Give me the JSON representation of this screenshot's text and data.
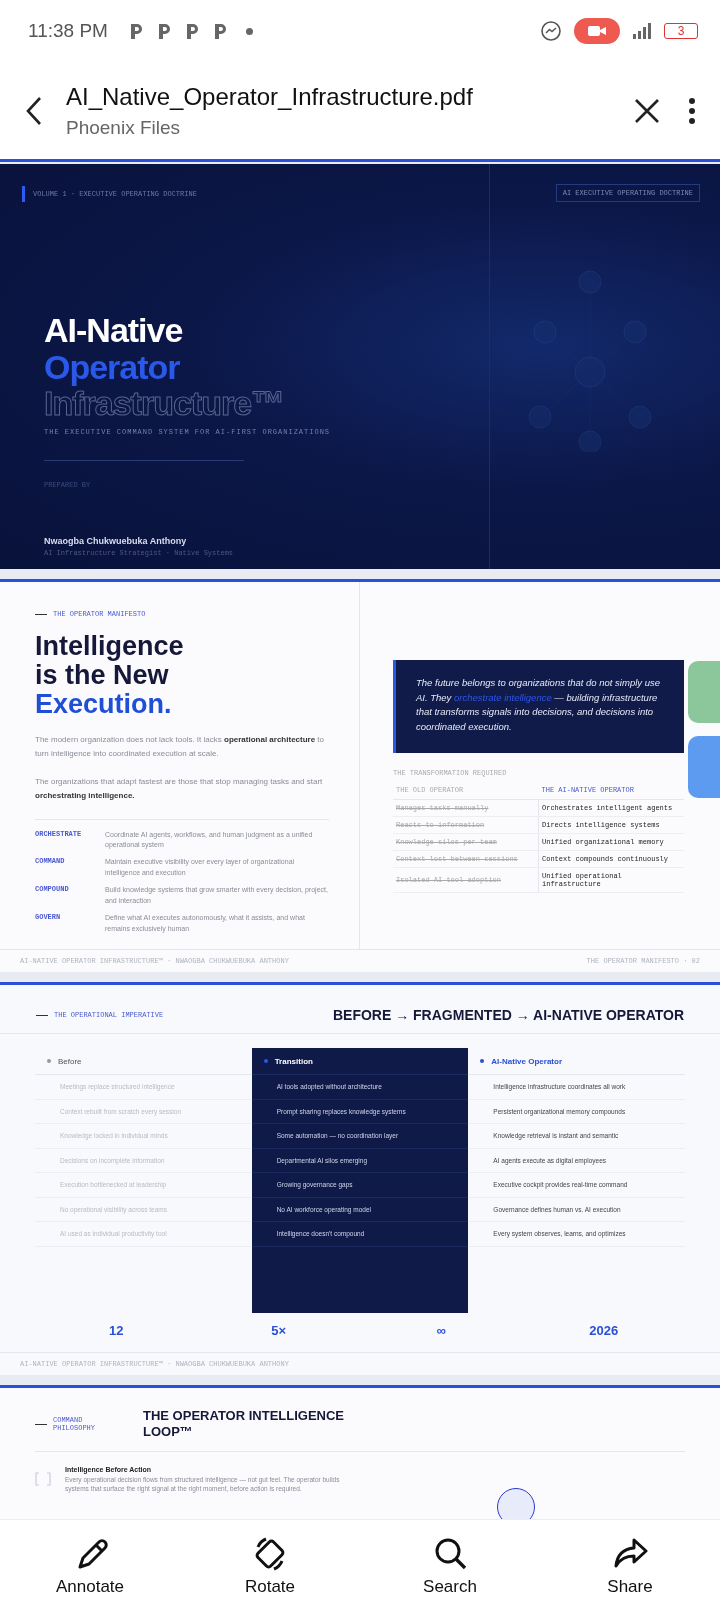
{
  "status_bar": {
    "time": "11:38 PM",
    "battery": "3"
  },
  "app_bar": {
    "title": "AI_Native_Operator_Infrastructure.pdf",
    "subtitle": "Phoenix Files"
  },
  "cover": {
    "eyebrow": "VOLUME 1 · EXECUTIVE OPERATING DOCTRINE",
    "badge": "AI EXECUTIVE OPERATING DOCTRINE",
    "title": [
      {
        "text": "AI-Native",
        "kind": "solid"
      },
      {
        "text": "Operator",
        "kind": "accent"
      },
      {
        "text": "Infrastructure™",
        "kind": "outline"
      }
    ],
    "subtitle": "THE EXECUTIVE COMMAND SYSTEM FOR AI-FIRST ORGANIZATIONS",
    "prepared_label": "PREPARED BY",
    "author": "Nwaogba Chukwuebuka Anthony",
    "author_role": "AI Infrastructure Strategist · Native Systems"
  },
  "manifesto": {
    "eyebrow": "THE OPERATOR MANIFESTO",
    "heading": [
      {
        "text": "Intelligence",
        "kind": "solid"
      },
      {
        "text": "is the New",
        "kind": "solid"
      },
      {
        "text": "Execution.",
        "kind": "accent"
      }
    ],
    "paragraphs": [
      "The modern organization does not lack tools. It lacks **operational architecture** to turn intelligence into coordinated execution at scale.",
      "The organizations that adapt fastest are those that stop managing tasks and start **orchestrating intelligence.**"
    ],
    "principles": [
      {
        "key": "ORCHESTRATE",
        "text": "Coordinate AI agents, workflows, and human judgment as a unified operational system"
      },
      {
        "key": "COMMAND",
        "text": "Maintain executive visibility over every layer of organizational intelligence and execution"
      },
      {
        "key": "COMPOUND",
        "text": "Build knowledge systems that grow smarter with every decision, project, and interaction"
      },
      {
        "key": "GOVERN",
        "text": "Define what AI executes autonomously, what it assists, and what remains exclusively human"
      }
    ],
    "quote": {
      "before": "The future belongs to organizations that do not simply use AI. They ",
      "highlight": "orchestrate intelligence",
      "after": " — building infrastructure that transforms signals into decisions, and decisions into coordinated execution."
    },
    "table_title": "THE TRANSFORMATION REQUIRED",
    "columns": [
      "THE OLD OPERATOR",
      "THE AI-NATIVE OPERATOR"
    ],
    "rows": [
      [
        "Manages tasks manually",
        "Orchestrates intelligent agents"
      ],
      [
        "Reacts to information",
        "Directs intelligence systems"
      ],
      [
        "Knowledge silos per team",
        "Unified organizational memory"
      ],
      [
        "Context lost between sessions",
        "Context compounds continuously"
      ],
      [
        "Isolated AI tool adoption",
        "Unified operational infrastructure"
      ]
    ],
    "footer_left": "AI-NATIVE OPERATOR INFRASTRUCTURE™ · NWAOGBA CHUKWUEBUKA ANTHONY",
    "footer_right": "THE OPERATOR MANIFESTO · 02"
  },
  "imperative": {
    "eyebrow": "THE OPERATIONAL IMPERATIVE",
    "heading": "BEFORE → FRAGMENTED → AI-NATIVE OPERATOR",
    "columns": [
      {
        "title": "Before",
        "kind": "before",
        "items": [
          "Meetings replace structured intelligence",
          "Context rebuilt from scratch every session",
          "Knowledge locked in individual minds",
          "Decisions on incomplete information",
          "Execution bottlenecked at leadership",
          "No operational visibility across teams",
          "AI used as individual productivity tool"
        ]
      },
      {
        "title": "Transition",
        "kind": "transition",
        "items": [
          "AI tools adopted without architecture",
          "Prompt sharing replaces knowledge systems",
          "Some automation — no coordination layer",
          "Departmental AI silos emerging",
          "Growing governance gaps",
          "No AI workforce operating model",
          "Intelligence doesn't compound"
        ]
      },
      {
        "title": "AI-Native Operator",
        "kind": "native",
        "items": [
          "Intelligence infrastructure coordinates all work",
          "Persistent organizational memory compounds",
          "Knowledge retrieval is instant and semantic",
          "AI agents execute as digital employees",
          "Executive cockpit provides real-time command",
          "Governance defines human vs. AI execution",
          "Every system observes, learns, and optimizes"
        ]
      }
    ],
    "stats": [
      "12",
      "5×",
      "∞",
      "2026"
    ],
    "footer_left": "AI-NATIVE OPERATOR INFRASTRUCTURE™ · NWAOGBA CHUKWUEBUKA ANTHONY"
  },
  "loop": {
    "eyebrow": "COMMAND PHILOSOPHY",
    "heading": "THE OPERATOR INTELLIGENCE LOOP™",
    "item_title": "Intelligence Before Action",
    "item_text": "Every operational decision flows from structured intelligence — not gut feel. The operator builds systems that surface the right signal at the right moment, before action is required."
  },
  "bottom_bar": [
    {
      "label": "Annotate"
    },
    {
      "label": "Rotate"
    },
    {
      "label": "Search"
    },
    {
      "label": "Share"
    }
  ]
}
